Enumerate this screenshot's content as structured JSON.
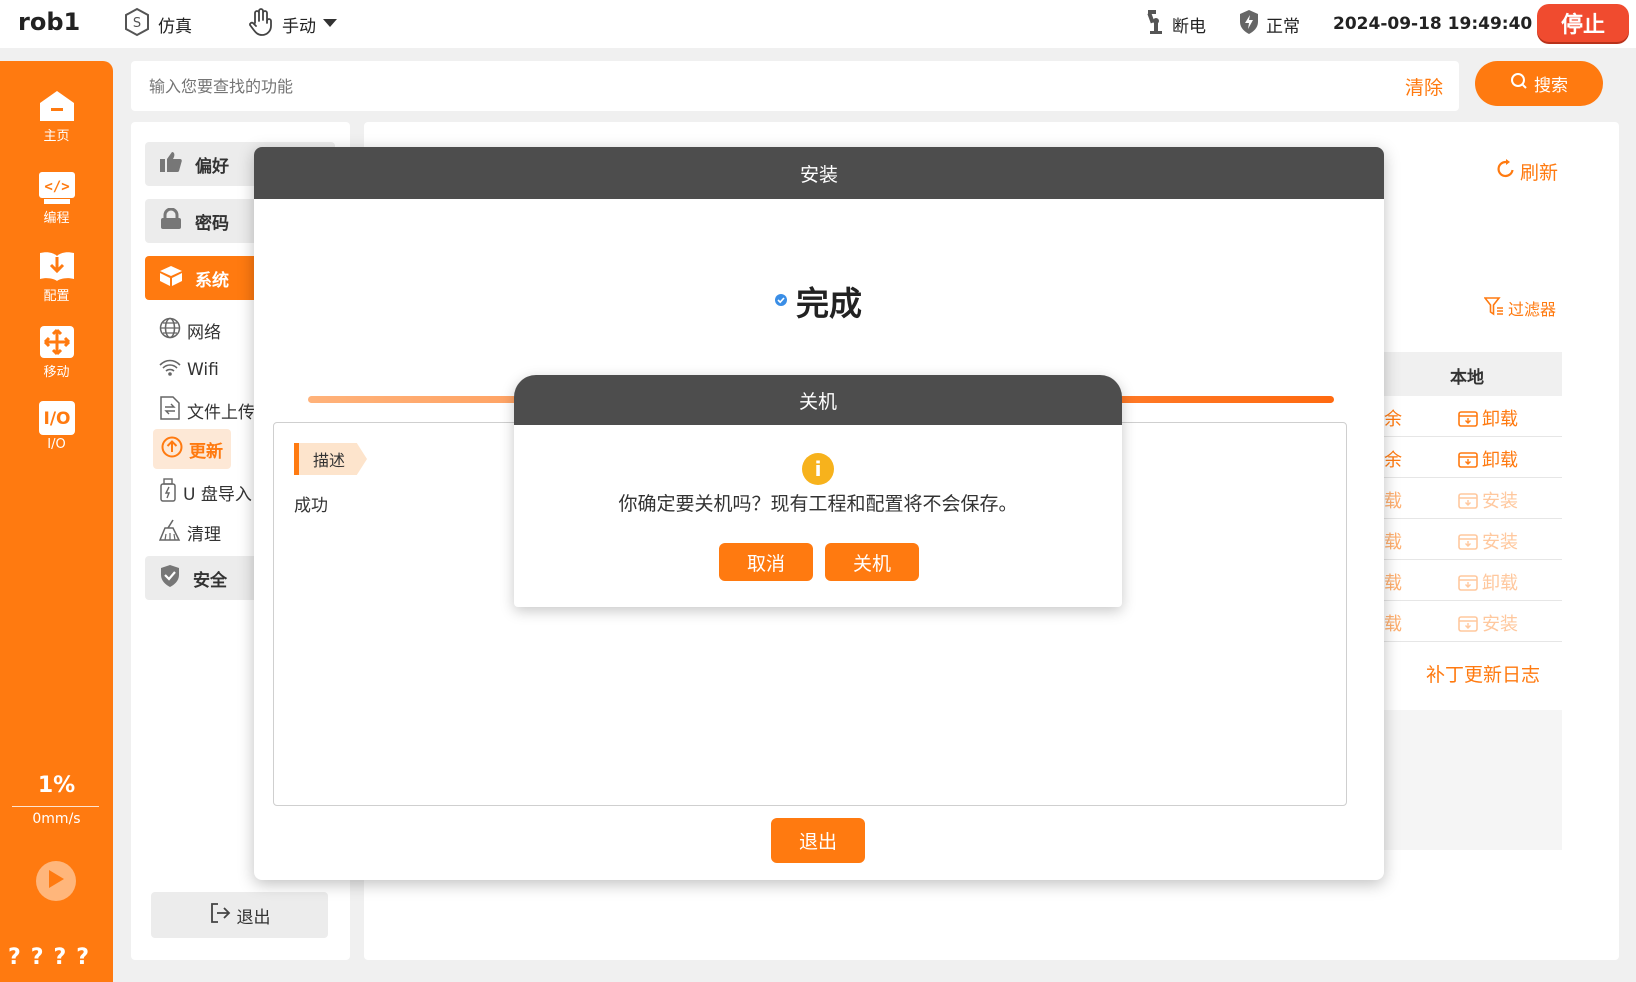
{
  "topbar": {
    "robot_name": "rob1",
    "mode_label": "仿真",
    "control_label": "手动",
    "power_label": "断电",
    "safety_label": "正常",
    "datetime": "2024-09-18 19:49:40",
    "stop_label": "停止"
  },
  "sidebar": {
    "home": "主页",
    "program": "编程",
    "config": "配置",
    "move": "移动",
    "io": "I/O",
    "speed_percent": "1%",
    "speed_value": "0mm/s",
    "help_marks": "????"
  },
  "search": {
    "placeholder": "输入您要查找的功能",
    "clear_label": "清除",
    "button_label": "搜索"
  },
  "settings": {
    "preference": "偏好",
    "password": "密码",
    "system": "系统",
    "network": "网络",
    "wifi": "Wifi",
    "file_upload": "文件上传",
    "update": "更新",
    "usb_import": "U 盘导入",
    "clean": "清理",
    "safety": "安全",
    "exit": "退出"
  },
  "content": {
    "refresh": "刷新",
    "filter": "过滤器",
    "local_header": "本地",
    "rows": [
      {
        "frag": "余",
        "action": "卸载",
        "faded": false
      },
      {
        "frag": "余",
        "action": "卸载",
        "faded": false
      },
      {
        "frag": "载",
        "action": "安装",
        "faded": true
      },
      {
        "frag": "载",
        "action": "安装",
        "faded": true
      },
      {
        "frag": "载",
        "action": "卸载",
        "faded": true
      },
      {
        "frag": "载",
        "action": "安装",
        "faded": true
      }
    ],
    "patch_log": "补丁更新日志"
  },
  "install_modal": {
    "title": "安装",
    "status": "完成",
    "tag": "描述",
    "log_text": "成功",
    "exit_label": "退出"
  },
  "shutdown_modal": {
    "title": "关机",
    "message": "你确定要关机吗？现有工程和配置将不会保存。",
    "cancel_label": "取消",
    "confirm_label": "关机",
    "warn_glyph": "i"
  },
  "colors": {
    "accent": "#ff7a10",
    "stop": "#f04b2f",
    "modal_header": "#4d4d4d",
    "warning": "#f7b21c",
    "success": "#3a8ee6"
  }
}
